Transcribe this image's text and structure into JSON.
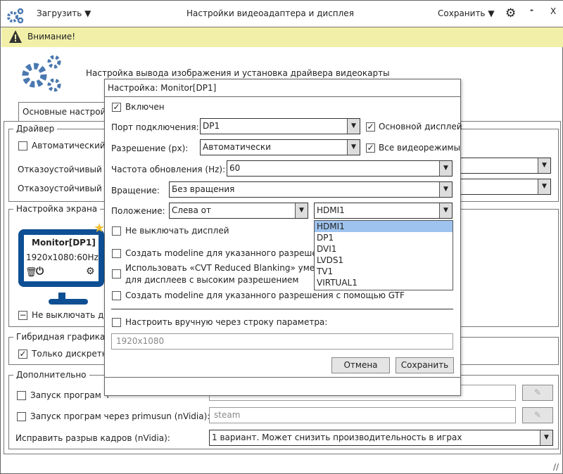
{
  "titlebar": {
    "load_label": "Загрузить",
    "title": "Настройки видеоадаптера и дисплея",
    "save_label": "Сохранить",
    "minimize": "-",
    "close": "X"
  },
  "warning": {
    "text": "Внимание!"
  },
  "header": {
    "text": "Настройка вывода изображения и установка драйвера видеокарты"
  },
  "tabs": [
    {
      "label": "Основные настройки"
    }
  ],
  "driver": {
    "legend": "Драйвер",
    "auto_label": "Автоматический в",
    "fallback1_label": "Отказоустойчивый др",
    "fallback2_label": "Отказоустойчивый др"
  },
  "screen": {
    "legend": "Настройка экрана",
    "monitor_name": "Monitor[DP1]",
    "monitor_mode": "1920x1080:60Hz",
    "no_off_label": "Не выключать ди"
  },
  "hybrid": {
    "legend": "Гибридная графика",
    "discrete_label": "Только дискретн"
  },
  "extra": {
    "legend": "Дополнительно",
    "run1_label": "Запуск програм ч",
    "run2_label": "Запуск програм через primusun (nVidia):",
    "run2_value": "steam",
    "tearing_label": "Исправить разрыв кадров (nVidia):",
    "tearing_value": "1 вариант. Может снизить производительность в играх"
  },
  "dialog": {
    "title": "Настройка: Monitor[DP1]",
    "enabled_label": "Включен",
    "port_label": "Порт подключения:",
    "port_value": "DP1",
    "primary_label": "Основной дисплей",
    "resolution_label": "Разрешение (px):",
    "resolution_value": "Автоматически",
    "allmodes_label": "Все видеорежимы",
    "refresh_label": "Частота обновления (Hz):",
    "refresh_value": "60",
    "rotation_label": "Вращение:",
    "rotation_value": "Без вращения",
    "position_label": "Положение:",
    "position_value": "Слева от",
    "position_target": "HDMI1",
    "position_options": [
      "HDMI1",
      "DP1",
      "DVI1",
      "LVDS1",
      "TV1",
      "VIRTUAL1"
    ],
    "nooff_label": "Не выключать дисплей",
    "modeline_cvt_label": "Создать modeline для указанного разрешения",
    "reduced_label_1": "Использовать «CVT Reduced Blanking» умень",
    "reduced_label_2": "для дисплеев с высоким разрешением",
    "modeline_gtf_label": "Создать modeline для указанного разрешения с помощью GTF",
    "manual_label": "Настроить вручную через строку параметра:",
    "manual_value": "1920x1080",
    "cancel_label": "Отмена",
    "save_label": "Сохранить"
  },
  "colors": {
    "accent": "#4a78b0",
    "monitor": "#0e4f94",
    "warning_bg": "#f2f0a8",
    "selected": "#9ec3ee",
    "star": "#f0c030"
  }
}
